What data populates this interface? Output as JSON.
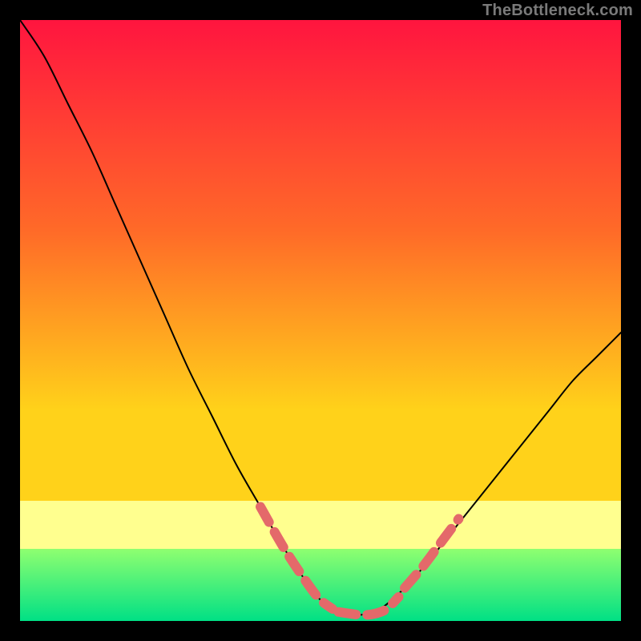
{
  "watermark": "TheBottleneck.com",
  "colors": {
    "background": "#000000",
    "gradient_top": "#ff153f",
    "gradient_mid1": "#ff6a28",
    "gradient_mid2": "#ffd21a",
    "gradient_band": "#ffff8f",
    "gradient_green_top": "#8fff70",
    "gradient_green_bottom": "#00e085",
    "curve_stroke": "#000000",
    "marker_stroke": "#e4696a"
  },
  "chart_data": {
    "type": "line",
    "title": "",
    "xlabel": "",
    "ylabel": "",
    "xlim": [
      0,
      100
    ],
    "ylim": [
      0,
      100
    ],
    "series": [
      {
        "name": "bottleneck-curve",
        "x": [
          0,
          4,
          8,
          12,
          16,
          20,
          24,
          28,
          32,
          36,
          40,
          44,
          48,
          50,
          52,
          54,
          56,
          58,
          60,
          64,
          68,
          72,
          76,
          80,
          84,
          88,
          92,
          96,
          100
        ],
        "y": [
          100,
          94,
          86,
          78,
          69,
          60,
          51,
          42,
          34,
          26,
          19,
          12,
          6,
          3.5,
          2,
          1.2,
          1,
          1.2,
          2,
          5.5,
          10,
          15,
          20,
          25,
          30,
          35,
          40,
          44,
          48
        ]
      }
    ],
    "markers": {
      "name": "highlight-segments",
      "segments": [
        {
          "x": [
            40,
            44,
            48,
            50,
            52
          ],
          "y": [
            19,
            12,
            6,
            3.5,
            2
          ]
        },
        {
          "x": [
            53,
            55,
            57,
            59,
            61,
            63
          ],
          "y": [
            1.5,
            1.2,
            1.0,
            1.2,
            2.0,
            4.0
          ]
        },
        {
          "x": [
            64,
            67,
            70,
            73
          ],
          "y": [
            5.5,
            9,
            13,
            17
          ]
        }
      ]
    }
  }
}
